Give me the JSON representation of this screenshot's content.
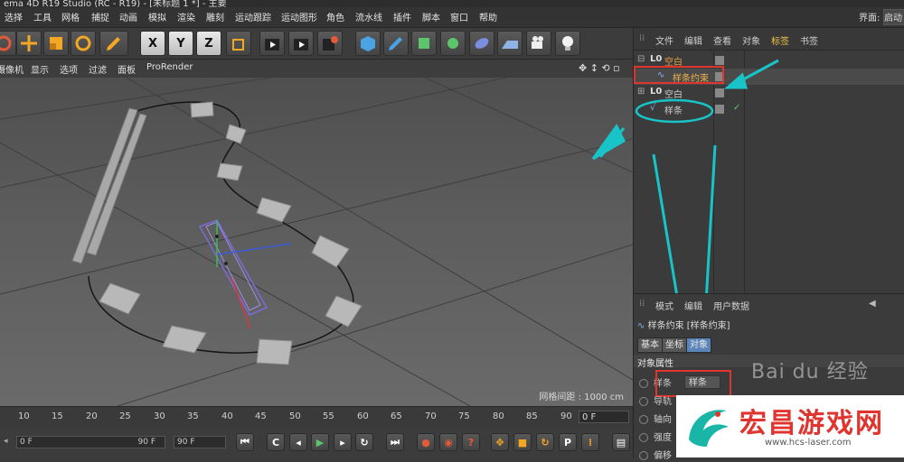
{
  "window": {
    "title": "ema 4D R19 Studio (RC - R19) - [未标题 1 *] - 主要"
  },
  "menu": {
    "items": [
      "选择",
      "工具",
      "网格",
      "捕捉",
      "动画",
      "模拟",
      "渲染",
      "雕刻",
      "运动跟踪",
      "运动图形",
      "角色",
      "流水线",
      "插件",
      "脚本",
      "窗口",
      "帮助"
    ],
    "layout_label": "界面:",
    "layout_value": "启动"
  },
  "toolbar": {
    "axis_x": "X",
    "axis_y": "Y",
    "axis_z": "Z"
  },
  "viewport": {
    "menu": [
      "摄像机",
      "显示",
      "选项",
      "过滤",
      "面板",
      "ProRender"
    ],
    "grid_spacing": "网格间距 : 1000 cm"
  },
  "object_manager": {
    "tabs": [
      "文件",
      "编辑",
      "查看",
      "对象",
      "标签",
      "书签"
    ],
    "objects": [
      {
        "name": "空白",
        "color": "#e8a23c"
      },
      {
        "name": "样条约束",
        "color": "#f2b34a"
      },
      {
        "name": "空白",
        "color": "#cfcfcf"
      },
      {
        "name": "样条",
        "color": "#cfcfcf"
      }
    ]
  },
  "attribute_manager": {
    "tabs": [
      "模式",
      "编辑",
      "用户数据"
    ],
    "title": "样条约束 [样条约束]",
    "subtabs": [
      "基本",
      "坐标",
      "对象"
    ],
    "section": "对象属性",
    "props": [
      {
        "label": "样条",
        "value": "样条"
      },
      {
        "label": "导轨"
      },
      {
        "label": "轴向"
      },
      {
        "label": "强度"
      },
      {
        "label": "偏移"
      }
    ]
  },
  "timeline": {
    "ticks": [
      "10",
      "15",
      "20",
      "25",
      "30",
      "35",
      "40",
      "45",
      "50",
      "55",
      "60",
      "65",
      "70",
      "75",
      "80",
      "85",
      "90"
    ],
    "current_frame": "0 F"
  },
  "transport": {
    "start_field": "0 F",
    "end_field": "90 F",
    "fps_field": "90 F"
  },
  "watermark": {
    "title": "宏昌游戏网",
    "url": "www.hcs-laser.com",
    "baidu": "Bai du 经验"
  },
  "colors": {
    "highlight_red": "#e0352f",
    "annotation_cyan": "#19c4c8",
    "selected_tab": "#f0c24a"
  }
}
